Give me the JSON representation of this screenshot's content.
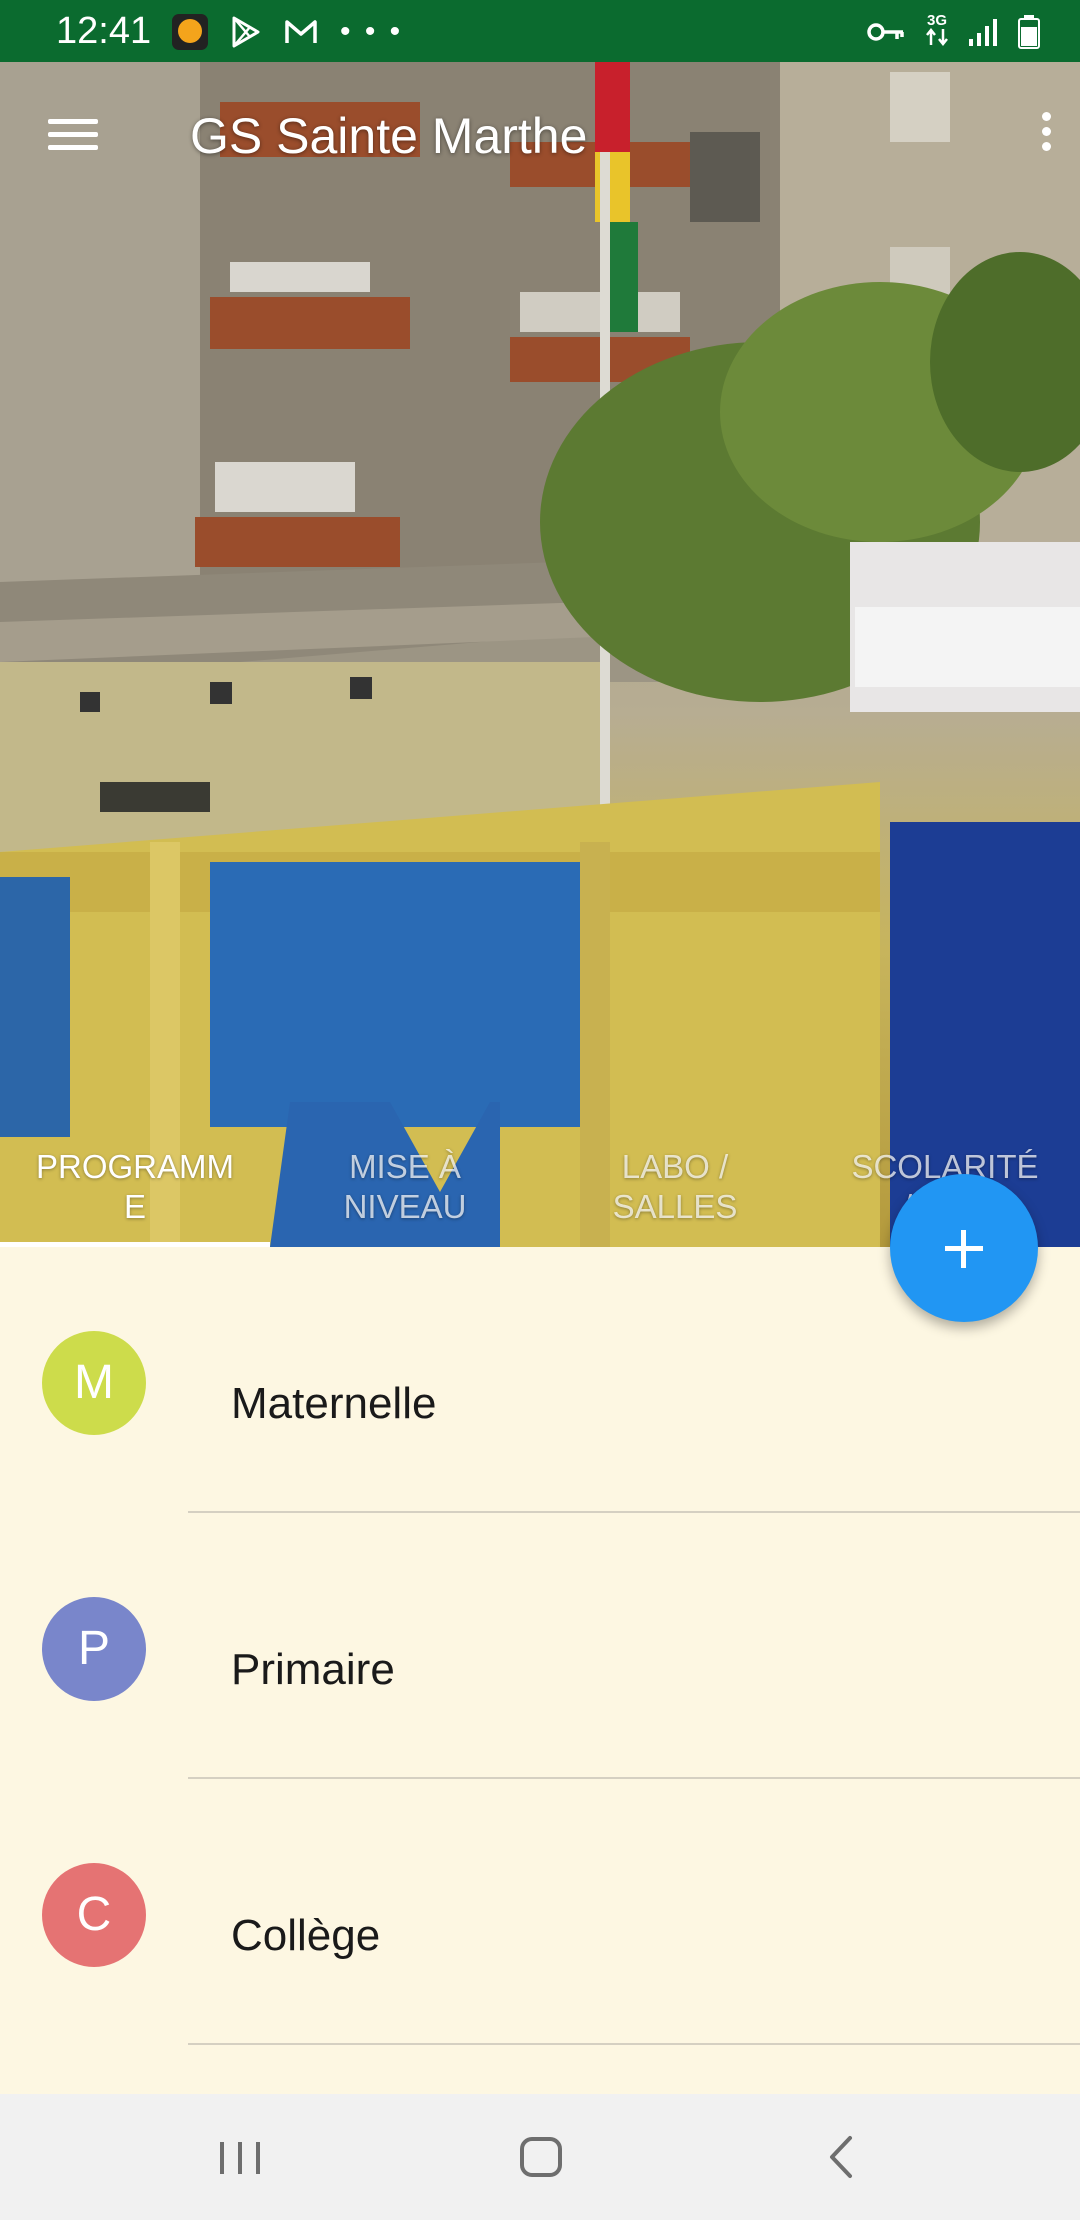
{
  "status_bar": {
    "time": "12:41",
    "network": "3G",
    "left_icons": [
      "vpn-icon",
      "play-store-icon",
      "gmail-icon",
      "more-dots-icon"
    ],
    "right_icons": [
      "vpn-key-icon",
      "network-3g-icon",
      "signal-icon",
      "battery-icon"
    ],
    "more": "• • •"
  },
  "app_bar": {
    "title": "GS Sainte Marthe",
    "menu_icon": "hamburger-menu-icon",
    "overflow_icon": "overflow-menu-icon"
  },
  "hero": {
    "image_description_icon": "school-building-photo"
  },
  "tabs": [
    {
      "label": "PROGRAMM\nE",
      "active": true
    },
    {
      "label": "MISE À\nNIVEAU",
      "active": false
    },
    {
      "label": "LABO /\nSALLES",
      "active": false
    },
    {
      "label": "SCOLARITÉ\n/ IN…",
      "active": false
    }
  ],
  "fab": {
    "icon": "plus-icon",
    "color": "#2196f3"
  },
  "list": {
    "items": [
      {
        "initial": "M",
        "label": "Maternelle",
        "color": "#cddc4b"
      },
      {
        "initial": "P",
        "label": "Primaire",
        "color": "#7986cb"
      },
      {
        "initial": "C",
        "label": "Collège",
        "color": "#e57373"
      }
    ]
  },
  "colors": {
    "status_bar": "#0b6b2f",
    "background": "#fdf7e2"
  },
  "nav_bar": {
    "icons": [
      "recent-apps-icon",
      "home-icon",
      "back-icon"
    ]
  }
}
